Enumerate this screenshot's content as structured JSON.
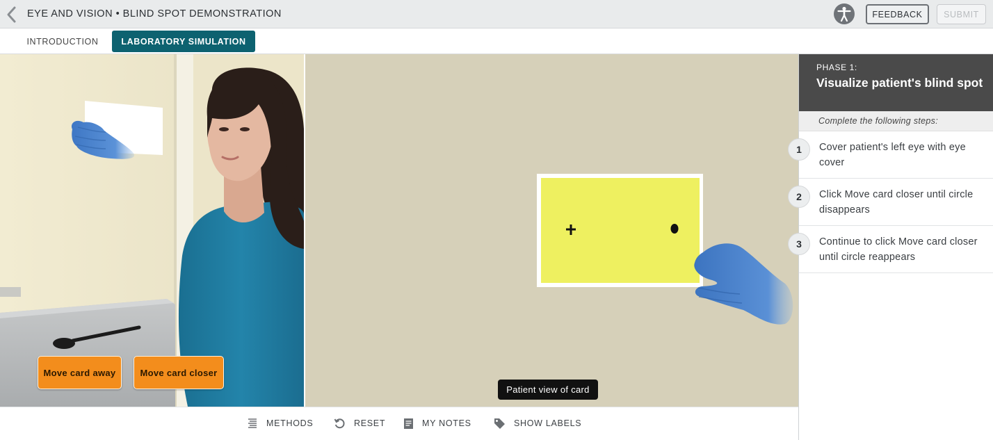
{
  "header": {
    "title": "EYE AND VISION • BLIND SPOT DEMONSTRATION",
    "back_icon": "chevron-left-icon",
    "accessibility_icon": "accessibility-icon",
    "feedback_label": "FEEDBACK",
    "submit_label": "SUBMIT"
  },
  "tabs": [
    {
      "label": "INTRODUCTION",
      "active": false
    },
    {
      "label": "LABORATORY SIMULATION",
      "active": true
    }
  ],
  "simulation": {
    "move_away_label": "Move card away",
    "move_closer_label": "Move card closer",
    "patient_view_label": "Patient view of card",
    "card_color": "#eef060",
    "glove_color": "#4f86d0"
  },
  "toolbar": [
    {
      "label": "METHODS",
      "icon": "list-icon"
    },
    {
      "label": "RESET",
      "icon": "reset-icon"
    },
    {
      "label": "MY NOTES",
      "icon": "notes-icon"
    },
    {
      "label": "SHOW LABELS",
      "icon": "tag-icon"
    }
  ],
  "panel": {
    "phase_label": "PHASE 1:",
    "phase_title": "Visualize patient's blind spot",
    "instruction": "Complete the following steps:",
    "steps": [
      {
        "number": "1",
        "text": "Cover patient's left eye with eye cover"
      },
      {
        "number": "2",
        "text": "Click Move card closer until circle disappears"
      },
      {
        "number": "3",
        "text": "Continue to click Move card closer until circle reappears"
      }
    ]
  },
  "colors": {
    "accent": "#0d6270",
    "action_button": "#f38d1c",
    "phase_header": "#4a4a4a"
  }
}
